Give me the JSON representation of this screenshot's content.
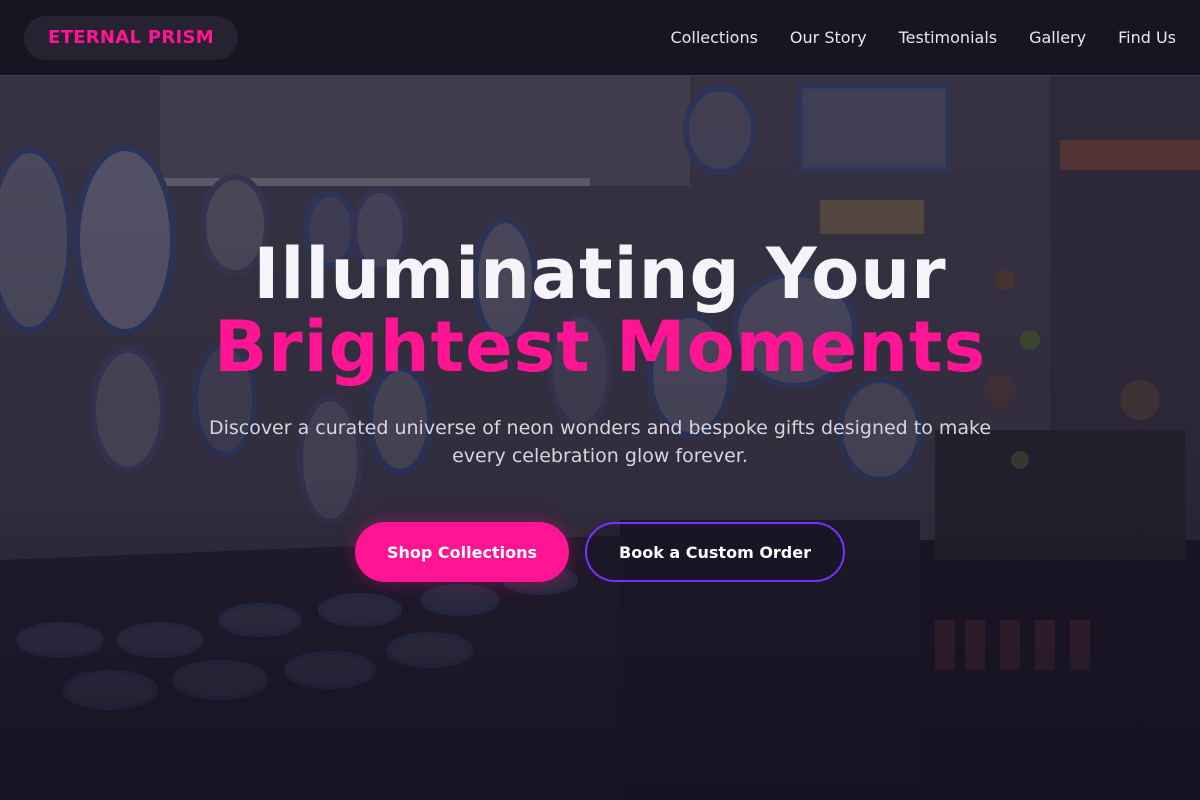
{
  "navbar": {
    "brand": "ETERNAL PRISM",
    "links": [
      {
        "label": "Collections"
      },
      {
        "label": "Our Story"
      },
      {
        "label": "Testimonials"
      },
      {
        "label": "Gallery"
      },
      {
        "label": "Find Us"
      }
    ]
  },
  "hero": {
    "headline_line1": "Illuminating Your",
    "headline_line2": "Brightest Moments",
    "subtitle": "Discover a curated universe of neon wonders and bespoke gifts designed to make every celebration glow forever.",
    "primary_cta": "Shop Collections",
    "secondary_cta": "Book a Custom Order"
  },
  "colors": {
    "accent_pink": "#ff1493",
    "accent_purple": "#7b2fff",
    "nav_background": "#14121e",
    "hero_overlay": "#141020"
  }
}
